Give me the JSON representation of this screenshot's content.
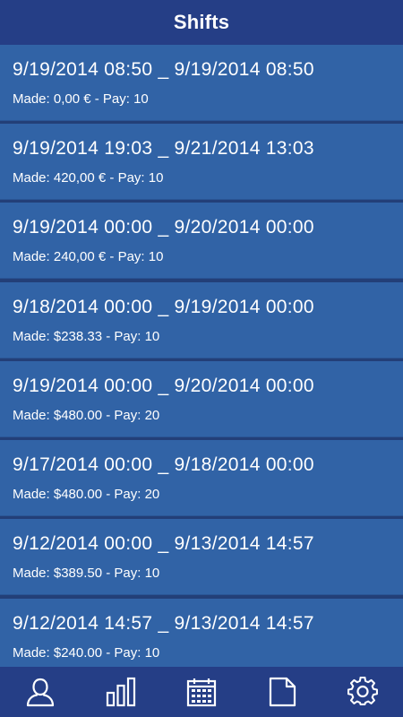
{
  "header": {
    "title": "Shifts"
  },
  "shifts": [
    {
      "range": "9/19/2014 08:50 _ 9/19/2014 08:50",
      "meta": "Made: 0,00 € - Pay: 10"
    },
    {
      "range": "9/19/2014 19:03 _ 9/21/2014 13:03",
      "meta": "Made: 420,00 € - Pay: 10"
    },
    {
      "range": "9/19/2014 00:00 _ 9/20/2014 00:00",
      "meta": "Made: 240,00 € - Pay: 10"
    },
    {
      "range": "9/18/2014 00:00 _ 9/19/2014 00:00",
      "meta": "Made: $238.33 - Pay: 10"
    },
    {
      "range": "9/19/2014 00:00 _ 9/20/2014 00:00",
      "meta": "Made: $480.00 - Pay: 20"
    },
    {
      "range": "9/17/2014 00:00 _ 9/18/2014 00:00",
      "meta": "Made: $480.00 - Pay: 20"
    },
    {
      "range": "9/12/2014 00:00 _ 9/13/2014 14:57",
      "meta": "Made: $389.50 - Pay: 10"
    },
    {
      "range": "9/12/2014 14:57 _ 9/13/2014 14:57",
      "meta": "Made: $240.00 - Pay: 10"
    }
  ],
  "tabbar": {
    "items": [
      {
        "icon": "user-icon"
      },
      {
        "icon": "bar-chart-icon"
      },
      {
        "icon": "calendar-icon"
      },
      {
        "icon": "document-icon"
      },
      {
        "icon": "gear-icon"
      }
    ]
  },
  "colors": {
    "header": "#253e86",
    "row": "#3163a6",
    "divider": "#233f78",
    "text": "#ffffff"
  }
}
